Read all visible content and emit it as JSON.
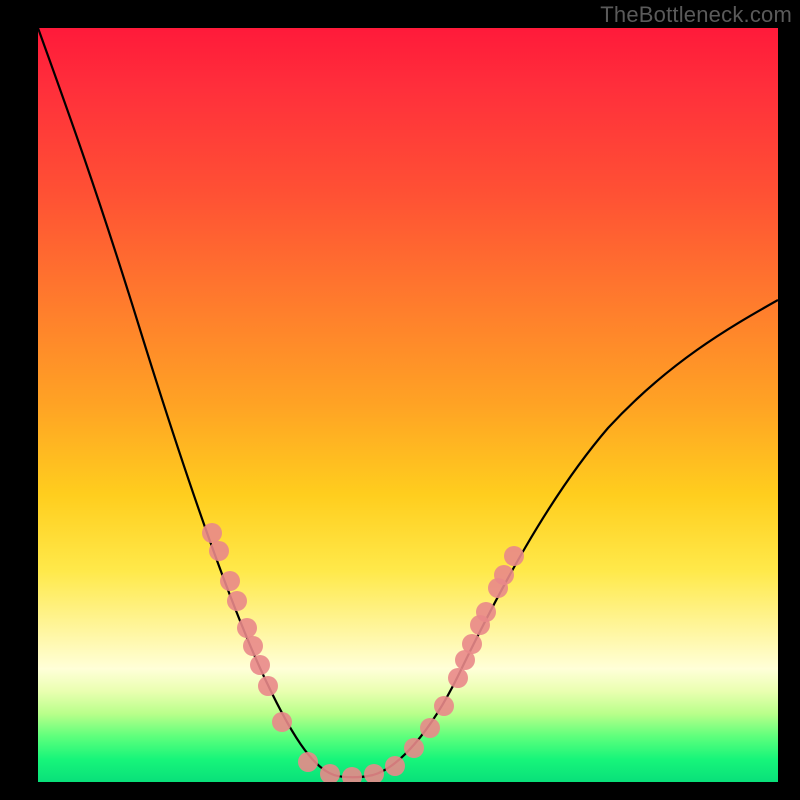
{
  "watermark": "TheBottleneck.com",
  "chart_data": {
    "type": "line",
    "title": "",
    "xlabel": "",
    "ylabel": "",
    "xlim": [
      0,
      100
    ],
    "ylim": [
      0,
      100
    ],
    "series": [
      {
        "name": "bottleneck-curve",
        "x": [
          0,
          4,
          8,
          12,
          16,
          20,
          24,
          28,
          32,
          34,
          36,
          38,
          40,
          42,
          44,
          48,
          52,
          56,
          60,
          66,
          72,
          80,
          88,
          96,
          100
        ],
        "y": [
          100,
          89,
          78,
          67,
          56,
          46,
          36,
          27,
          18,
          14,
          10,
          6,
          3,
          1,
          1,
          1,
          2,
          5,
          10,
          18,
          27,
          38,
          49,
          59,
          64
        ]
      }
    ],
    "markers": {
      "name": "sample-dots",
      "x": [
        25,
        26.5,
        28,
        29.5,
        31,
        32,
        33,
        34.5,
        37,
        40,
        42,
        44,
        46,
        48,
        50,
        52,
        54,
        56,
        58,
        60
      ],
      "y": [
        34,
        31,
        27,
        24,
        20,
        18,
        16,
        13,
        7,
        3,
        1,
        1,
        1,
        2,
        3,
        5,
        7,
        10,
        13,
        17
      ]
    },
    "gradient_stops": [
      {
        "pos": 0,
        "color": "#ff1a3a"
      },
      {
        "pos": 50,
        "color": "#ffa324"
      },
      {
        "pos": 80,
        "color": "#fff6a0"
      },
      {
        "pos": 100,
        "color": "#09e07a"
      }
    ]
  }
}
